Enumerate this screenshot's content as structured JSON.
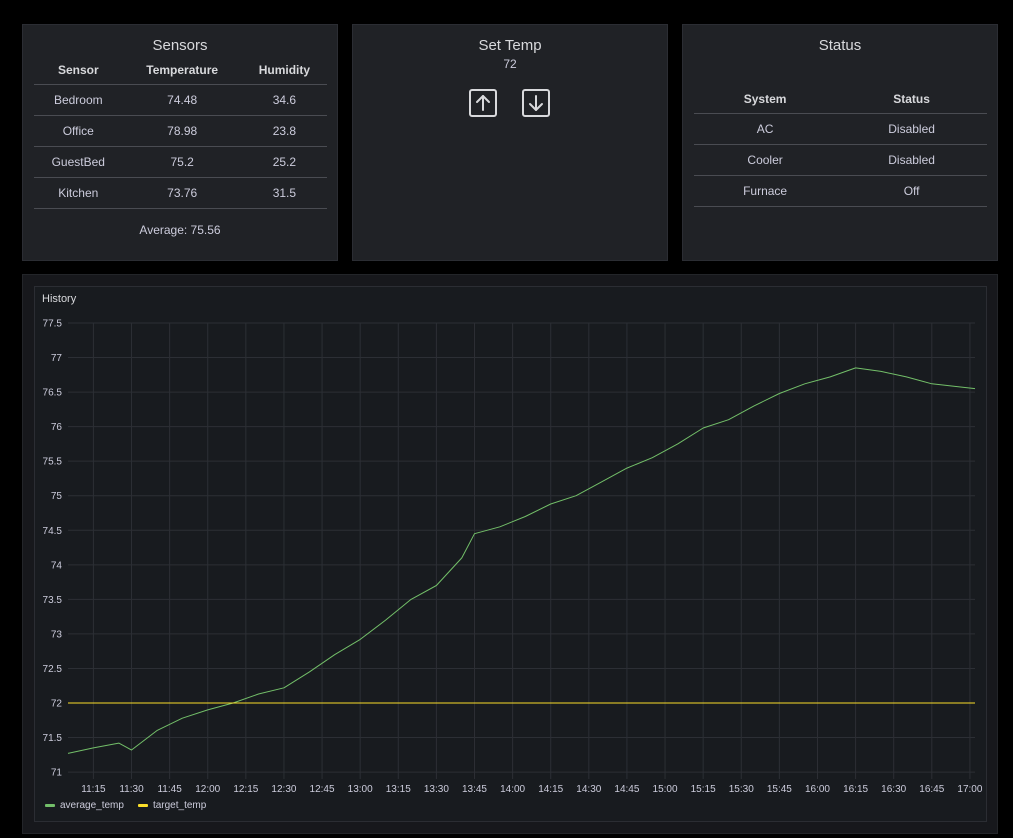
{
  "sensors": {
    "title": "Sensors",
    "columns": [
      "Sensor",
      "Temperature",
      "Humidity"
    ],
    "rows": [
      [
        "Bedroom",
        "74.48",
        "34.6"
      ],
      [
        "Office",
        "78.98",
        "23.8"
      ],
      [
        "GuestBed",
        "75.2",
        "25.2"
      ],
      [
        "Kitchen",
        "73.76",
        "31.5"
      ]
    ],
    "average": "Average: 75.56"
  },
  "set_temp": {
    "title": "Set Temp",
    "value": "72",
    "up_icon": "arrow-up-icon",
    "down_icon": "arrow-down-icon"
  },
  "status": {
    "title": "Status",
    "columns": [
      "System",
      "Status"
    ],
    "rows": [
      [
        "AC",
        "Disabled"
      ],
      [
        "Cooler",
        "Disabled"
      ],
      [
        "Furnace",
        "Off"
      ]
    ]
  },
  "history": {
    "title": "History"
  },
  "colors": {
    "avg_line": "#73bf69",
    "target_line": "#fade2a",
    "grid": "#2c2f35",
    "text": "#ccccdc"
  },
  "chart_data": {
    "type": "line",
    "title": "History",
    "xlabel": "",
    "ylabel": "",
    "ylim": [
      70.9,
      77.5
    ],
    "x_ticks": [
      "11:15",
      "11:30",
      "11:45",
      "12:00",
      "12:15",
      "12:30",
      "12:45",
      "13:00",
      "13:15",
      "13:30",
      "13:45",
      "14:00",
      "14:15",
      "14:30",
      "14:45",
      "15:00",
      "15:15",
      "15:30",
      "15:45",
      "16:00",
      "16:15",
      "16:30",
      "16:45",
      "17:00"
    ],
    "y_ticks": [
      71,
      71.5,
      72,
      72.5,
      73,
      73.5,
      74,
      74.5,
      75,
      75.5,
      76,
      76.5,
      77,
      77.5
    ],
    "xlim": [
      "11:05",
      "17:02"
    ],
    "legend": "bottom-left",
    "grid": true,
    "series": [
      {
        "name": "average_temp",
        "x": [
          "11:05",
          "11:15",
          "11:25",
          "11:30",
          "11:40",
          "11:50",
          "12:00",
          "12:10",
          "12:20",
          "12:30",
          "12:40",
          "12:50",
          "13:00",
          "13:10",
          "13:20",
          "13:30",
          "13:40",
          "13:45",
          "13:55",
          "14:05",
          "14:15",
          "14:25",
          "14:35",
          "14:45",
          "14:55",
          "15:05",
          "15:15",
          "15:25",
          "15:35",
          "15:45",
          "15:55",
          "16:05",
          "16:15",
          "16:25",
          "16:35",
          "16:45",
          "16:55",
          "17:02"
        ],
        "values": [
          71.27,
          71.35,
          71.42,
          71.32,
          71.6,
          71.78,
          71.9,
          72.0,
          72.13,
          72.22,
          72.45,
          72.7,
          72.92,
          73.2,
          73.5,
          73.7,
          74.1,
          74.45,
          74.55,
          74.7,
          74.88,
          75.0,
          75.2,
          75.4,
          75.55,
          75.75,
          75.98,
          76.1,
          76.3,
          76.48,
          76.62,
          76.72,
          76.85,
          76.8,
          76.72,
          76.62,
          76.58,
          76.55
        ]
      },
      {
        "name": "target_temp",
        "x": [
          "11:05",
          "17:02"
        ],
        "values": [
          72,
          72
        ]
      }
    ]
  }
}
